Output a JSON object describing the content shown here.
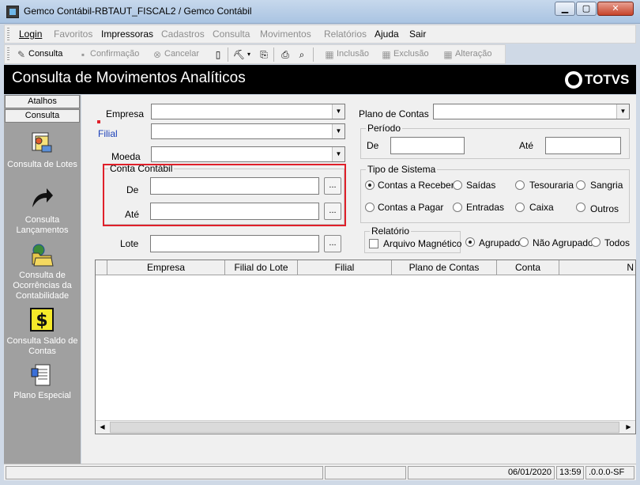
{
  "window": {
    "title": "Gemco Contábil-RBTAUT_FISCAL2 / Gemco Contábil",
    "min": "▁",
    "max": "▢",
    "close": "✕"
  },
  "menu": {
    "items": [
      {
        "label": "Login",
        "disabled": false
      },
      {
        "label": "Favoritos",
        "disabled": true
      },
      {
        "label": "Impressoras",
        "disabled": false
      },
      {
        "label": "Cadastros",
        "disabled": true
      },
      {
        "label": "Consulta",
        "disabled": true
      },
      {
        "label": "Movimentos",
        "disabled": true
      },
      {
        "label": "Relatórios",
        "disabled": true
      },
      {
        "label": "Ajuda",
        "disabled": false
      },
      {
        "label": "Sair",
        "disabled": false
      }
    ]
  },
  "toolbar": {
    "consulta": "Consulta",
    "confirmacao": "Confirmação",
    "cancelar": "Cancelar",
    "inclusao": "Inclusão",
    "exclusao": "Exclusão",
    "alteracao": "Alteração"
  },
  "header": {
    "title": "Consulta de Movimentos Analíticos",
    "brand": "TOTVS"
  },
  "sidebar": {
    "tabs": [
      "Atalhos",
      "Consulta"
    ],
    "items": [
      {
        "label": "Consulta de Lotes",
        "icon": "lotes-icon"
      },
      {
        "label": "Consulta Lançamentos",
        "icon": "arrow-icon"
      },
      {
        "label": "Consulta de Ocorrências da Contabilidade",
        "icon": "folder-globe-icon"
      },
      {
        "label": "Consulta Saldo de Contas",
        "icon": "money-icon"
      },
      {
        "label": "Plano Especial",
        "icon": "document-icon"
      }
    ]
  },
  "form": {
    "empresa": {
      "label": "Empresa",
      "value": ""
    },
    "filial": {
      "label": "Filial",
      "value": ""
    },
    "moeda": {
      "label": "Moeda",
      "value": ""
    },
    "conta_contabil": {
      "title": "Conta Contábil",
      "de_label": "De",
      "de_value": "",
      "ate_label": "Até",
      "ate_value": "",
      "ellipsis": "..."
    },
    "lote": {
      "label": "Lote",
      "value": "",
      "ellipsis": "..."
    },
    "plano_de_contas": {
      "label": "Plano de Contas",
      "value": ""
    },
    "periodo": {
      "title": "Período",
      "de_label": "De",
      "de_value": "",
      "ate_label": "Até",
      "ate_value": ""
    },
    "tipo_sistema": {
      "title": "Tipo de Sistema",
      "options": [
        {
          "label": "Contas a Receber",
          "checked": true
        },
        {
          "label": "Saídas",
          "checked": false
        },
        {
          "label": "Tesouraria",
          "checked": false
        },
        {
          "label": "Sangria",
          "checked": false
        },
        {
          "label": "Contas a Pagar",
          "checked": false
        },
        {
          "label": "Entradas",
          "checked": false
        },
        {
          "label": "Caixa",
          "checked": false
        },
        {
          "label": "Outros",
          "checked": false
        }
      ]
    },
    "relatorio": {
      "title": "Relatório",
      "arquivo_magnetico": "Arquivo Magnético",
      "arquivo_magnetico_checked": false
    },
    "agrupamento": [
      {
        "label": "Agrupado",
        "checked": true
      },
      {
        "label": "Não Agrupado",
        "checked": false
      },
      {
        "label": "Todos",
        "checked": false
      }
    ]
  },
  "grid": {
    "columns": [
      "Empresa",
      "Filial do Lote",
      "Filial",
      "Plano de Contas",
      "Conta Contábil",
      "N"
    ]
  },
  "statusbar": {
    "date": "06/01/2020",
    "time": "13:59",
    "version": ".0.0.0-SF"
  },
  "colors": {
    "highlight": "#e0202a",
    "header_bg": "#000000",
    "sidebar_bg": "#a0a0a0"
  }
}
